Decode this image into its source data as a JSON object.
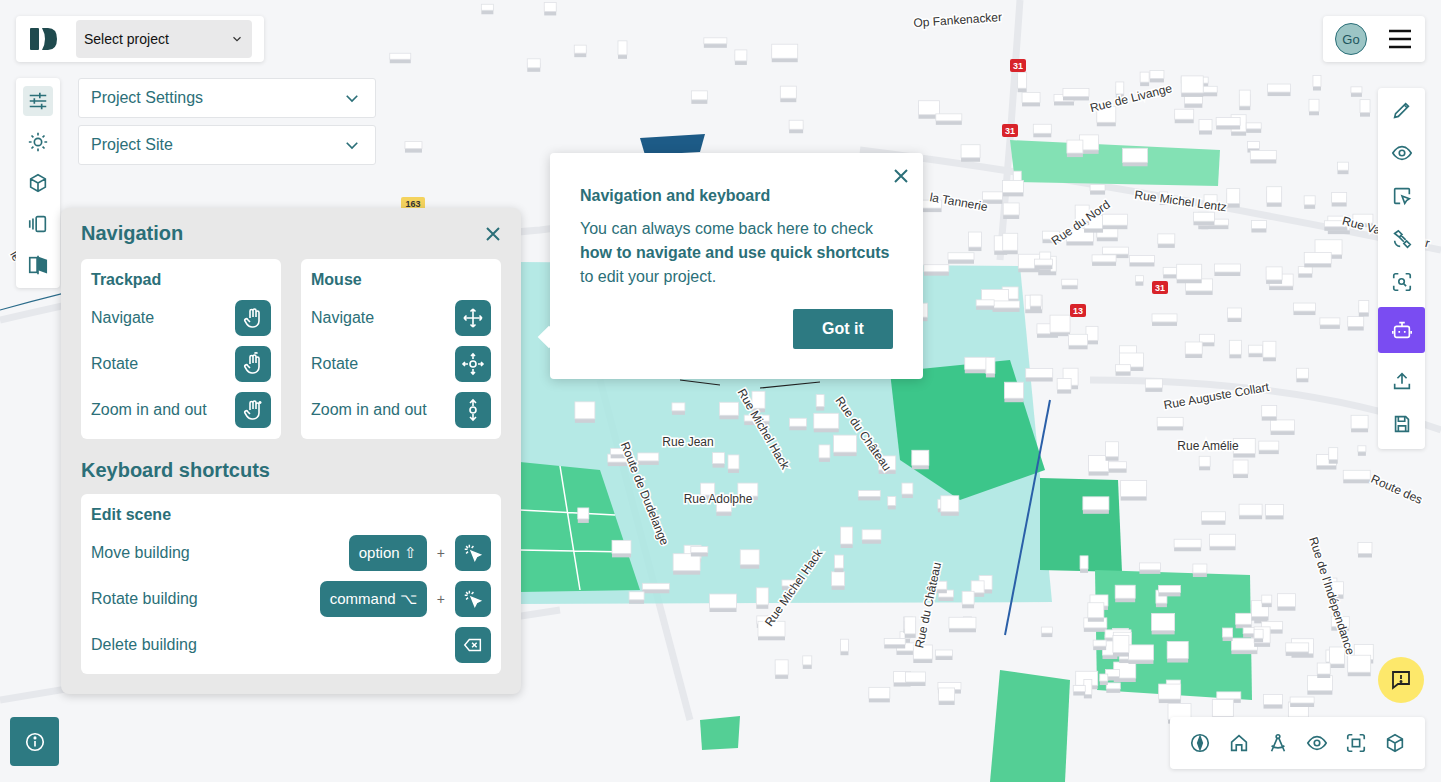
{
  "project_select": {
    "placeholder": "Select project"
  },
  "user": {
    "initials": "Go"
  },
  "left_toolbar": [
    {
      "selected": true
    },
    {
      "selected": false
    },
    {
      "selected": false
    },
    {
      "selected": false
    },
    {
      "selected": false
    }
  ],
  "dropdowns": [
    {
      "label": "Project Settings",
      "expanded": false
    },
    {
      "label": "Project Site",
      "expanded": false
    }
  ],
  "navigation_panel": {
    "title": "Navigation",
    "input_groups": [
      {
        "title": "Trackpad",
        "rows": [
          {
            "label": "Navigate"
          },
          {
            "label": "Rotate"
          },
          {
            "label": "Zoom in and out"
          }
        ]
      },
      {
        "title": "Mouse",
        "rows": [
          {
            "label": "Navigate"
          },
          {
            "label": "Rotate"
          },
          {
            "label": "Zoom in and out"
          }
        ]
      }
    ],
    "shortcuts_title": "Keyboard shortcuts",
    "shortcut_section": {
      "title": "Edit scene",
      "rows": [
        {
          "label": "Move building",
          "kind": "combo",
          "key": "option ⇧",
          "plus": "+"
        },
        {
          "label": "Rotate building",
          "kind": "combo",
          "key": "command ⌥",
          "plus": "+"
        },
        {
          "label": "Delete building",
          "kind": "delete"
        }
      ]
    }
  },
  "tooltip": {
    "title": "Navigation and keyboard",
    "text_before": "You can always come back here to check ",
    "text_bold": "how to navigate and use quick shortcuts",
    "text_after": " to edit your project.",
    "button": "Got it"
  },
  "right_toolbar": [
    {
      "selected": false
    },
    {
      "selected": false
    },
    {
      "selected": false
    },
    {
      "selected": false
    },
    {
      "selected": false
    },
    {
      "selected": true
    },
    {
      "selected": false
    },
    {
      "selected": false
    }
  ],
  "map": {
    "labels": [
      {
        "text": "Op Fankenacker",
        "kind": "street"
      },
      {
        "text": "Rue de Livange",
        "kind": "street"
      },
      {
        "text": "31",
        "kind": "route-red"
      },
      {
        "text": "31",
        "kind": "route-red"
      },
      {
        "text": "31",
        "kind": "route-red"
      },
      {
        "text": "13",
        "kind": "route-red"
      },
      {
        "text": "163",
        "kind": "route-yellow"
      },
      {
        "text": "la Tannerie",
        "kind": "street"
      },
      {
        "text": "Rue du Nord",
        "kind": "street"
      },
      {
        "text": "Rue Michel Lentz",
        "kind": "street"
      },
      {
        "text": "Rue Valérie Schr",
        "kind": "street"
      },
      {
        "text": "Rue Auguste Collart",
        "kind": "street"
      },
      {
        "text": "Rue Amélie",
        "kind": "street"
      },
      {
        "text": "Route des",
        "kind": "street"
      },
      {
        "text": "Rue de l'Indépendance",
        "kind": "street"
      },
      {
        "text": "Route de Dudelange",
        "kind": "street"
      },
      {
        "text": "Rue Michel Hack",
        "kind": "street"
      },
      {
        "text": "Rue du Château",
        "kind": "street"
      },
      {
        "text": "Rue Jean",
        "kind": "street"
      },
      {
        "text": "Rue Adolphe",
        "kind": "street"
      },
      {
        "text": "Rue Michel Hack",
        "kind": "street"
      },
      {
        "text": "Rue du Château",
        "kind": "street"
      },
      {
        "text": "le",
        "kind": "street"
      }
    ]
  }
}
